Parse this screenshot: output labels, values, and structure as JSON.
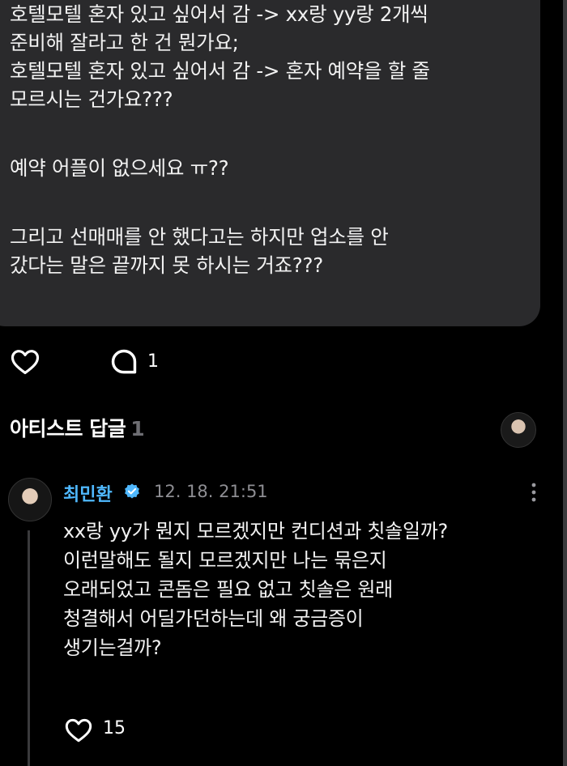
{
  "post": {
    "lines": [
      "호텔모텔 혼자 있고 싶어서 감 -> xx랑 yy랑 2개씩",
      "준비해 잘라고 한 건 뭔가요;",
      "호텔모텔 혼자 있고 싶어서 감 -> 혼자 예약을 할 줄",
      "모르시는 건가요???",
      "예약 어플이 없으세요 ㅠ??",
      "그리고 선매매를 안 했다고는 하지만 업소를 안",
      "갔다는 말은 끝까지 못 하시는 거죠???"
    ]
  },
  "actions": {
    "comment_count": "1"
  },
  "artist_reply": {
    "title": "아티스트 답글",
    "count": "1"
  },
  "comment": {
    "author": "최민환",
    "timestamp": "12. 18. 21:51",
    "lines": [
      "xx랑 yy가 뭔지 모르겠지만 컨디션과 칫솔일까?",
      "이런말해도 될지 모르겠지만 나는 묶은지",
      "오래되었고 콘돔은 필요 없고 칫솔은 원래",
      "청결해서 어딜가던하는데 왜 궁금증이",
      "생기는걸까?"
    ],
    "like_count": "15"
  },
  "colors": {
    "background": "#000000",
    "card": "#2a2a2c",
    "author": "#4fb8ff",
    "muted": "#8e8e93"
  }
}
